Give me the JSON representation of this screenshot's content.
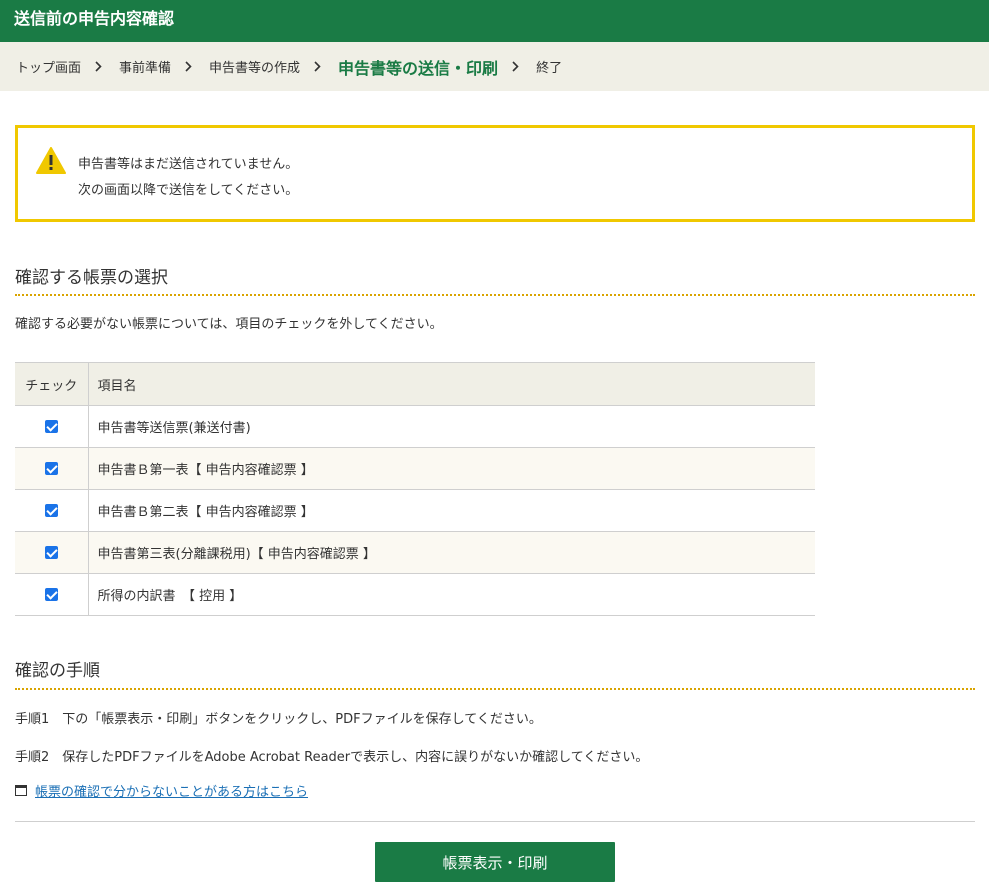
{
  "header": {
    "title": "送信前の申告内容確認"
  },
  "breadcrumb": {
    "items": [
      "トップ画面",
      "事前準備",
      "申告書等の作成",
      "申告書等の送信・印刷",
      "終了"
    ],
    "current_index": 3
  },
  "notice": {
    "icon": "warning-icon",
    "line1": "申告書等はまだ送信されていません。",
    "line2": "次の画面以降で送信をしてください。"
  },
  "selection": {
    "title": "確認する帳票の選択",
    "description": "確認する必要がない帳票については、項目のチェックを外してください。",
    "columns": [
      "チェック",
      "項目名"
    ],
    "rows": [
      {
        "checked": true,
        "name": "申告書等送信票(兼送付書)"
      },
      {
        "checked": true,
        "name": "申告書Ｂ第一表【 申告内容確認票 】"
      },
      {
        "checked": true,
        "name": "申告書Ｂ第二表【 申告内容確認票 】"
      },
      {
        "checked": true,
        "name": "申告書第三表(分離課税用)【 申告内容確認票 】"
      },
      {
        "checked": true,
        "name": "所得の内訳書　【 控用 】"
      }
    ]
  },
  "procedure": {
    "title": "確認の手順",
    "step1": "手順1　下の「帳票表示・印刷」ボタンをクリックし、PDFファイルを保存してください。",
    "step2": "手順2　保存したPDFファイルをAdobe Acrobat Readerで表示し、内容に誤りがないか確認してください。",
    "help_link": "帳票の確認で分からないことがある方はこちら"
  },
  "actions": {
    "print_button": "帳票表示・印刷"
  },
  "colors": {
    "brand_green": "#1a7b45",
    "warning_yellow": "#f0c800",
    "link_blue": "#1a6fb5"
  }
}
